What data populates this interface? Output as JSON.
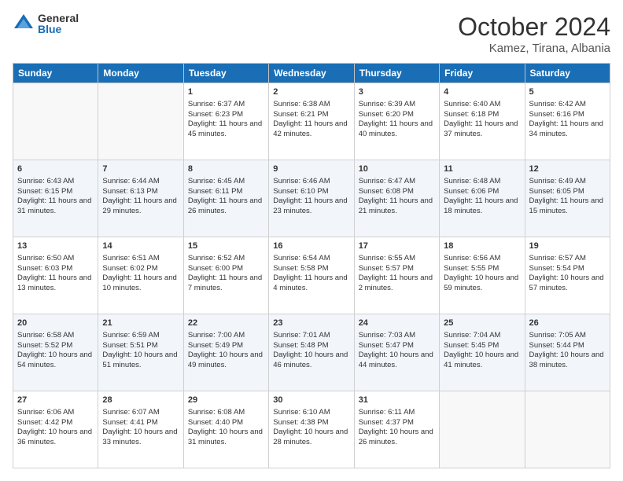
{
  "logo": {
    "general": "General",
    "blue": "Blue"
  },
  "header": {
    "month": "October 2024",
    "location": "Kamez, Tirana, Albania"
  },
  "days_of_week": [
    "Sunday",
    "Monday",
    "Tuesday",
    "Wednesday",
    "Thursday",
    "Friday",
    "Saturday"
  ],
  "weeks": [
    [
      {
        "day": "",
        "sunrise": "",
        "sunset": "",
        "daylight": ""
      },
      {
        "day": "",
        "sunrise": "",
        "sunset": "",
        "daylight": ""
      },
      {
        "day": "1",
        "sunrise": "Sunrise: 6:37 AM",
        "sunset": "Sunset: 6:23 PM",
        "daylight": "Daylight: 11 hours and 45 minutes."
      },
      {
        "day": "2",
        "sunrise": "Sunrise: 6:38 AM",
        "sunset": "Sunset: 6:21 PM",
        "daylight": "Daylight: 11 hours and 42 minutes."
      },
      {
        "day": "3",
        "sunrise": "Sunrise: 6:39 AM",
        "sunset": "Sunset: 6:20 PM",
        "daylight": "Daylight: 11 hours and 40 minutes."
      },
      {
        "day": "4",
        "sunrise": "Sunrise: 6:40 AM",
        "sunset": "Sunset: 6:18 PM",
        "daylight": "Daylight: 11 hours and 37 minutes."
      },
      {
        "day": "5",
        "sunrise": "Sunrise: 6:42 AM",
        "sunset": "Sunset: 6:16 PM",
        "daylight": "Daylight: 11 hours and 34 minutes."
      }
    ],
    [
      {
        "day": "6",
        "sunrise": "Sunrise: 6:43 AM",
        "sunset": "Sunset: 6:15 PM",
        "daylight": "Daylight: 11 hours and 31 minutes."
      },
      {
        "day": "7",
        "sunrise": "Sunrise: 6:44 AM",
        "sunset": "Sunset: 6:13 PM",
        "daylight": "Daylight: 11 hours and 29 minutes."
      },
      {
        "day": "8",
        "sunrise": "Sunrise: 6:45 AM",
        "sunset": "Sunset: 6:11 PM",
        "daylight": "Daylight: 11 hours and 26 minutes."
      },
      {
        "day": "9",
        "sunrise": "Sunrise: 6:46 AM",
        "sunset": "Sunset: 6:10 PM",
        "daylight": "Daylight: 11 hours and 23 minutes."
      },
      {
        "day": "10",
        "sunrise": "Sunrise: 6:47 AM",
        "sunset": "Sunset: 6:08 PM",
        "daylight": "Daylight: 11 hours and 21 minutes."
      },
      {
        "day": "11",
        "sunrise": "Sunrise: 6:48 AM",
        "sunset": "Sunset: 6:06 PM",
        "daylight": "Daylight: 11 hours and 18 minutes."
      },
      {
        "day": "12",
        "sunrise": "Sunrise: 6:49 AM",
        "sunset": "Sunset: 6:05 PM",
        "daylight": "Daylight: 11 hours and 15 minutes."
      }
    ],
    [
      {
        "day": "13",
        "sunrise": "Sunrise: 6:50 AM",
        "sunset": "Sunset: 6:03 PM",
        "daylight": "Daylight: 11 hours and 13 minutes."
      },
      {
        "day": "14",
        "sunrise": "Sunrise: 6:51 AM",
        "sunset": "Sunset: 6:02 PM",
        "daylight": "Daylight: 11 hours and 10 minutes."
      },
      {
        "day": "15",
        "sunrise": "Sunrise: 6:52 AM",
        "sunset": "Sunset: 6:00 PM",
        "daylight": "Daylight: 11 hours and 7 minutes."
      },
      {
        "day": "16",
        "sunrise": "Sunrise: 6:54 AM",
        "sunset": "Sunset: 5:58 PM",
        "daylight": "Daylight: 11 hours and 4 minutes."
      },
      {
        "day": "17",
        "sunrise": "Sunrise: 6:55 AM",
        "sunset": "Sunset: 5:57 PM",
        "daylight": "Daylight: 11 hours and 2 minutes."
      },
      {
        "day": "18",
        "sunrise": "Sunrise: 6:56 AM",
        "sunset": "Sunset: 5:55 PM",
        "daylight": "Daylight: 10 hours and 59 minutes."
      },
      {
        "day": "19",
        "sunrise": "Sunrise: 6:57 AM",
        "sunset": "Sunset: 5:54 PM",
        "daylight": "Daylight: 10 hours and 57 minutes."
      }
    ],
    [
      {
        "day": "20",
        "sunrise": "Sunrise: 6:58 AM",
        "sunset": "Sunset: 5:52 PM",
        "daylight": "Daylight: 10 hours and 54 minutes."
      },
      {
        "day": "21",
        "sunrise": "Sunrise: 6:59 AM",
        "sunset": "Sunset: 5:51 PM",
        "daylight": "Daylight: 10 hours and 51 minutes."
      },
      {
        "day": "22",
        "sunrise": "Sunrise: 7:00 AM",
        "sunset": "Sunset: 5:49 PM",
        "daylight": "Daylight: 10 hours and 49 minutes."
      },
      {
        "day": "23",
        "sunrise": "Sunrise: 7:01 AM",
        "sunset": "Sunset: 5:48 PM",
        "daylight": "Daylight: 10 hours and 46 minutes."
      },
      {
        "day": "24",
        "sunrise": "Sunrise: 7:03 AM",
        "sunset": "Sunset: 5:47 PM",
        "daylight": "Daylight: 10 hours and 44 minutes."
      },
      {
        "day": "25",
        "sunrise": "Sunrise: 7:04 AM",
        "sunset": "Sunset: 5:45 PM",
        "daylight": "Daylight: 10 hours and 41 minutes."
      },
      {
        "day": "26",
        "sunrise": "Sunrise: 7:05 AM",
        "sunset": "Sunset: 5:44 PM",
        "daylight": "Daylight: 10 hours and 38 minutes."
      }
    ],
    [
      {
        "day": "27",
        "sunrise": "Sunrise: 6:06 AM",
        "sunset": "Sunset: 4:42 PM",
        "daylight": "Daylight: 10 hours and 36 minutes."
      },
      {
        "day": "28",
        "sunrise": "Sunrise: 6:07 AM",
        "sunset": "Sunset: 4:41 PM",
        "daylight": "Daylight: 10 hours and 33 minutes."
      },
      {
        "day": "29",
        "sunrise": "Sunrise: 6:08 AM",
        "sunset": "Sunset: 4:40 PM",
        "daylight": "Daylight: 10 hours and 31 minutes."
      },
      {
        "day": "30",
        "sunrise": "Sunrise: 6:10 AM",
        "sunset": "Sunset: 4:38 PM",
        "daylight": "Daylight: 10 hours and 28 minutes."
      },
      {
        "day": "31",
        "sunrise": "Sunrise: 6:11 AM",
        "sunset": "Sunset: 4:37 PM",
        "daylight": "Daylight: 10 hours and 26 minutes."
      },
      {
        "day": "",
        "sunrise": "",
        "sunset": "",
        "daylight": ""
      },
      {
        "day": "",
        "sunrise": "",
        "sunset": "",
        "daylight": ""
      }
    ]
  ]
}
